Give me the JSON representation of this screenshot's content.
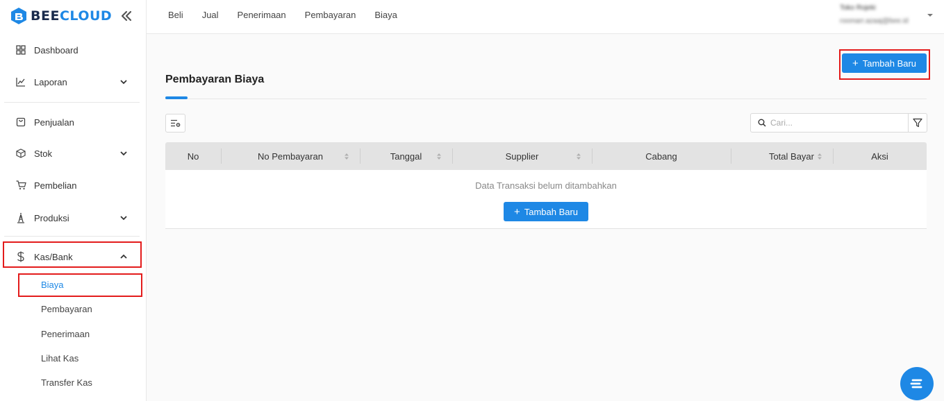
{
  "brand": {
    "prefix": "BEE",
    "suffix": "CLOUD"
  },
  "sidebar": {
    "items": [
      {
        "label": "Dashboard",
        "icon": "grid-icon"
      },
      {
        "label": "Laporan",
        "icon": "line-chart-icon",
        "expandable": true
      },
      {
        "label": "Penjualan",
        "icon": "shopping-bag-icon"
      },
      {
        "label": "Stok",
        "icon": "box-icon",
        "expandable": true
      },
      {
        "label": "Pembelian",
        "icon": "cart-icon"
      },
      {
        "label": "Produksi",
        "icon": "production-icon",
        "expandable": true
      },
      {
        "label": "Kas/Bank",
        "icon": "dollar-icon",
        "expandable": true,
        "expanded": true
      }
    ],
    "kas_sub_items": [
      {
        "label": "Biaya",
        "active": true
      },
      {
        "label": "Pembayaran"
      },
      {
        "label": "Penerimaan"
      },
      {
        "label": "Lihat Kas"
      },
      {
        "label": "Transfer Kas"
      }
    ]
  },
  "topnav": [
    "Beli",
    "Jual",
    "Penerimaan",
    "Pembayaran",
    "Biaya"
  ],
  "user": {
    "name": "Toko Rojeki",
    "email": "roomarr.azaaj@bee.id"
  },
  "main": {
    "add_button": "Tambah Baru",
    "page_title": "Pembayaran Biaya",
    "search_placeholder": "Cari...",
    "columns": [
      "No",
      "No Pembayaran",
      "Tanggal",
      "Supplier",
      "Cabang",
      "Total Bayar",
      "Aksi"
    ],
    "empty_text": "Data Transaksi belum ditambahkan",
    "empty_add_button": "Tambah Baru"
  },
  "colors": {
    "accent": "#1e88e5",
    "highlight": "#e31b1b"
  }
}
